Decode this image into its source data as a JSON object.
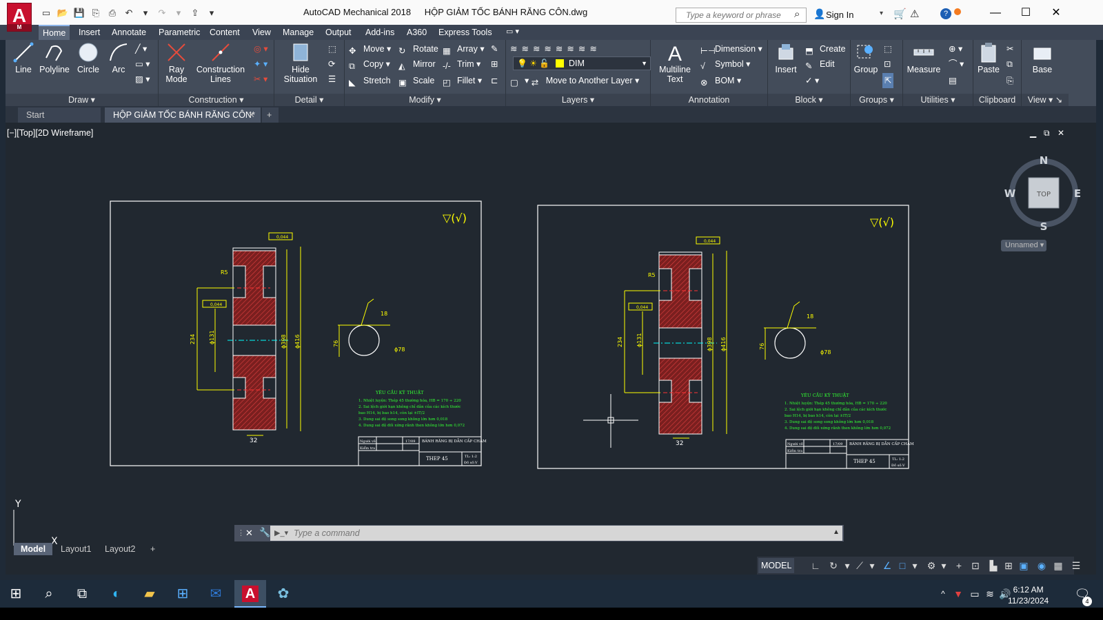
{
  "window": {
    "app_title": "AutoCAD Mechanical 2018",
    "file_title": "HỘP GIẢM TỐC BÁNH RĂNG CÔN.dwg",
    "logo_letter": "A",
    "logo_sub": "M"
  },
  "search": {
    "placeholder": "Type a keyword or phrase"
  },
  "account": {
    "sign_in": "Sign In"
  },
  "menu_tabs": [
    "Home",
    "Insert",
    "Annotate",
    "Parametric",
    "Content",
    "View",
    "Manage",
    "Output",
    "Add-ins",
    "A360",
    "Express Tools"
  ],
  "ribbon": {
    "draw": {
      "label": "Draw",
      "line": "Line",
      "polyline": "Polyline",
      "circle": "Circle",
      "arc": "Arc"
    },
    "construction": {
      "label": "Construction",
      "ray_mode": "Ray Mode",
      "construction_lines": "Construction Lines"
    },
    "detail": {
      "label": "Detail",
      "hide_situation": "Hide Situation"
    },
    "modify": {
      "label": "Modify",
      "move": "Move",
      "copy": "Copy",
      "stretch": "Stretch",
      "rotate": "Rotate",
      "mirror": "Mirror",
      "scale": "Scale",
      "array": "Array",
      "trim": "Trim",
      "fillet": "Fillet"
    },
    "layers": {
      "label": "Layers",
      "current_layer": "DIM",
      "move_to_layer": "Move to Another Layer"
    },
    "annotation": {
      "label": "Annotation",
      "multiline_text": "Multiline Text",
      "dimension": "Dimension",
      "symbol": "Symbol",
      "bom": "BOM"
    },
    "block": {
      "label": "Block",
      "insert": "Insert",
      "create": "Create",
      "edit": "Edit"
    },
    "groups": {
      "label": "Groups",
      "group": "Group"
    },
    "utilities": {
      "label": "Utilities",
      "measure": "Measure"
    },
    "clipboard": {
      "label": "Clipboard",
      "paste": "Paste"
    },
    "view": {
      "label": "View",
      "base": "Base"
    }
  },
  "doc_tabs": {
    "start": "Start",
    "active": "HỘP GIẢM TỐC BÁNH RĂNG CÔN*"
  },
  "viewport": {
    "label": "[−][Top][2D Wireframe]"
  },
  "viewcube": {
    "n": "N",
    "s": "S",
    "e": "E",
    "w": "W",
    "top": "TOP",
    "ucs_name": "Unnamed"
  },
  "drawing": {
    "dims": {
      "r5": "R5",
      "d131": "ϕ131",
      "d234": "234",
      "d398": "ϕ398",
      "d416": "ϕ416",
      "w32": "32",
      "t18": "18",
      "d76": "76",
      "d78": "ϕ78"
    },
    "tolerances": {
      "t1": "0,044",
      "t2": "0,044"
    },
    "notes_title": "YÊU CẦU KỸ THUẬT",
    "notes": [
      "1. Nhiệt luyện: Thép 45 thường hóa, HB = 170 ÷ 220",
      "2. Sai lệch giới hạn không chỉ dẫn của các kích thước",
      "bao H14, bị bao h14, còn lại ±IT/2",
      "3. Dung sai độ song song không lớn hơn 0,018",
      "4. Dung sai độ đối xứng rãnh then không lớn hơn 0,072"
    ],
    "title_block": {
      "part_name": "BÁNH RĂNG BỊ DẪN CẤP CHẬM",
      "material": "THEP 45",
      "drawn_by": "Người vẽ",
      "checked_by": "Kiểm tra",
      "date": "17/09",
      "scale": "TL: 1:2",
      "sheet": "Đồ số:V"
    }
  },
  "axes": {
    "x": "X",
    "y": "Y"
  },
  "command": {
    "placeholder": "Type a command"
  },
  "layout_tabs": [
    "Model",
    "Layout1",
    "Layout2"
  ],
  "status": {
    "model": "MODEL"
  },
  "clock": {
    "time": "6:12 AM",
    "date": "11/23/2024"
  },
  "notifications": {
    "count": "4"
  },
  "colors": {
    "accent": "#c8102e",
    "drawing_bg": "#212830",
    "ribbon": "#434c5a",
    "hatch": "#c0392b",
    "dim": "#ffff00"
  }
}
